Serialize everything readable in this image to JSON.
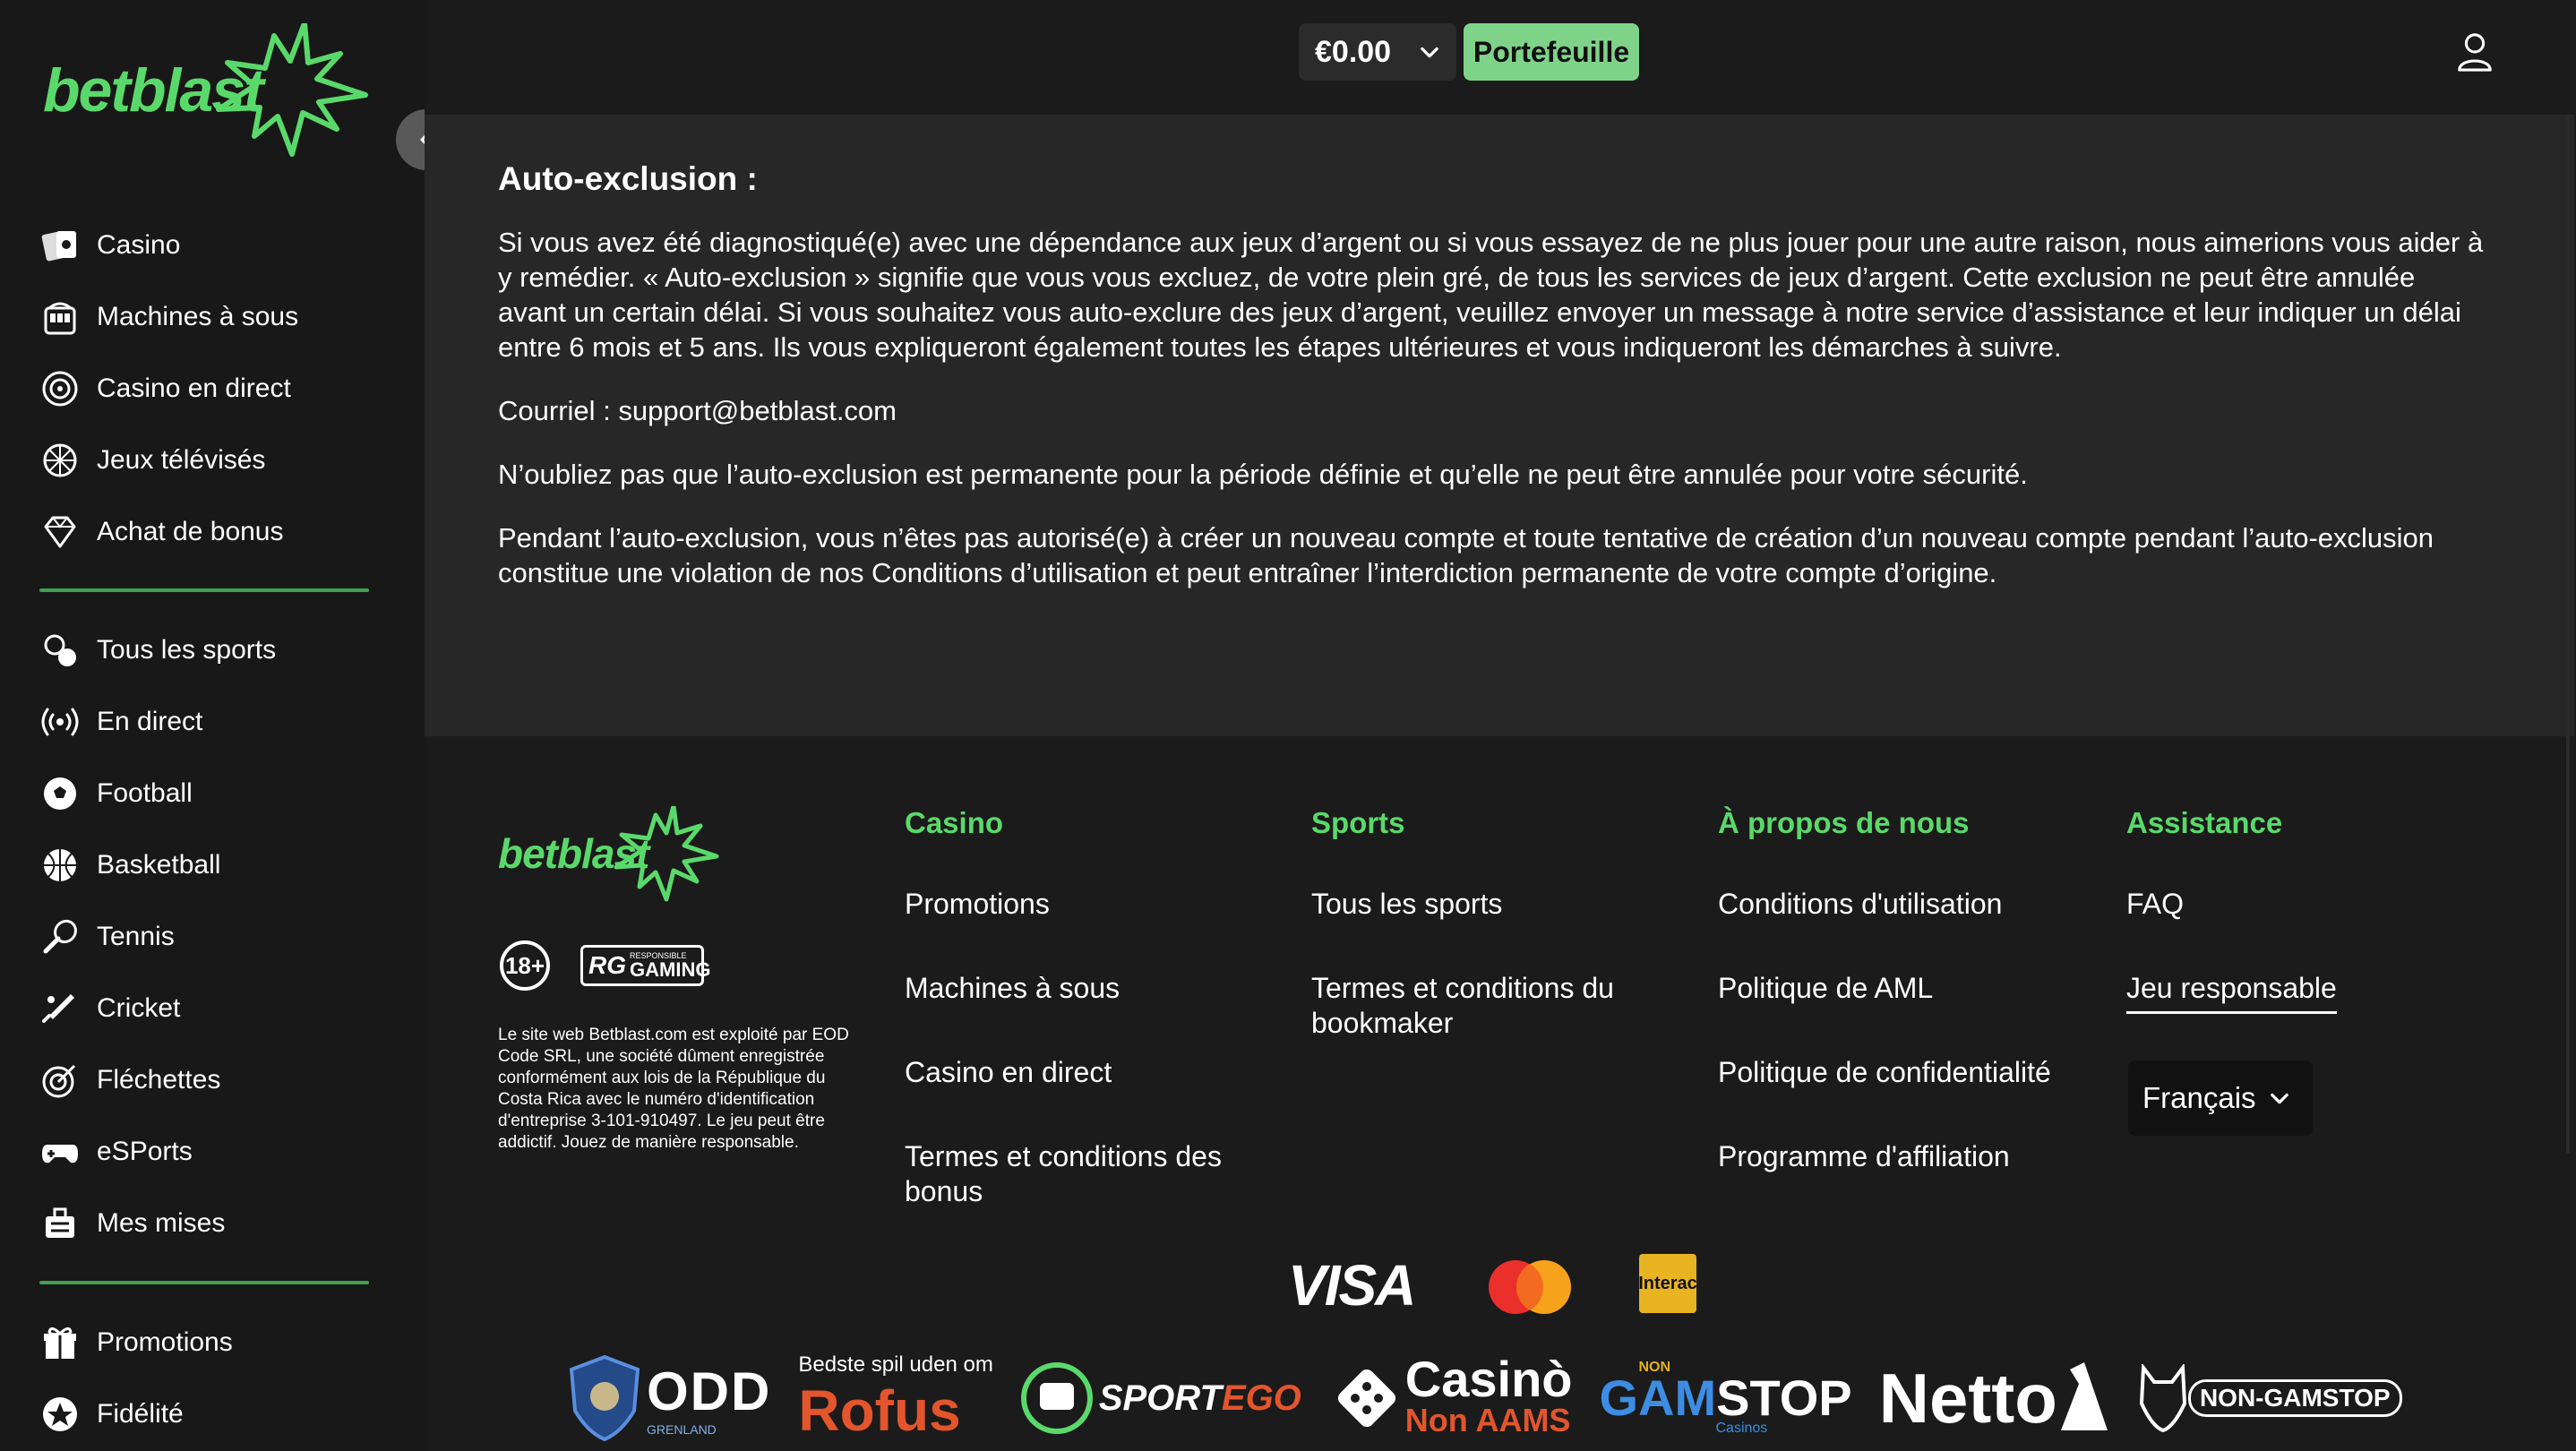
{
  "brand": {
    "name": "betblast",
    "accent": "#5ad96b",
    "button_color": "#7ed389"
  },
  "sidebar": {
    "group1": [
      {
        "icon": "cards-icon",
        "label": "Casino"
      },
      {
        "icon": "slot-machine-icon",
        "label": "Machines à sous"
      },
      {
        "icon": "roulette-icon",
        "label": "Casino en direct"
      },
      {
        "icon": "wheel-icon",
        "label": "Jeux télévisés"
      },
      {
        "icon": "diamond-icon",
        "label": "Achat de bonus"
      }
    ],
    "group2": [
      {
        "icon": "sports-icon",
        "label": "Tous les sports"
      },
      {
        "icon": "live-icon",
        "label": "En direct"
      },
      {
        "icon": "football-icon",
        "label": "Football"
      },
      {
        "icon": "basketball-icon",
        "label": "Basketball"
      },
      {
        "icon": "tennis-icon",
        "label": "Tennis"
      },
      {
        "icon": "cricket-icon",
        "label": "Cricket"
      },
      {
        "icon": "darts-icon",
        "label": "Fléchettes"
      },
      {
        "icon": "gamepad-icon",
        "label": "eSPorts"
      },
      {
        "icon": "bets-icon",
        "label": "Mes mises"
      }
    ],
    "group3": [
      {
        "icon": "gift-icon",
        "label": "Promotions"
      },
      {
        "icon": "star-icon",
        "label": "Fidélité"
      }
    ]
  },
  "topbar": {
    "balance": "€0.00",
    "wallet_label": "Portefeuille"
  },
  "content": {
    "heading": "Auto-exclusion :",
    "paragraphs": [
      "Si vous avez été diagnostiqué(e) avec une dépendance aux jeux d’argent ou si vous essayez de ne plus jouer pour une autre raison, nous aimerions vous aider à y remédier. « Auto-exclusion » signifie que vous vous excluez, de votre plein gré, de tous les services de jeux d’argent. Cette exclusion ne peut être annulée avant un certain délai. Si vous souhaitez vous auto-exclure des jeux d’argent, veuillez envoyer un message à notre service d’assistance et leur indiquer un délai entre 6 mois et 5 ans. Ils vous expliqueront également toutes les étapes ultérieures et vous indiqueront les démarches à suivre.",
      "Courriel : support@betblast.com",
      "N’oubliez pas que l’auto-exclusion est permanente pour la période définie et qu’elle ne peut être annulée pour votre sécurité.",
      "Pendant l’auto-exclusion, vous n’êtes pas autorisé(e) à créer un nouveau compte et toute tentative de création d’un nouveau compte pendant l’auto-exclusion constitue une violation de nos Conditions d’utilisation et peut entraîner l’interdiction permanente de votre compte d’origine."
    ]
  },
  "footer": {
    "badge_18": "18+",
    "rg_small": "RESPONSIBLE",
    "rg_big": "GAMING",
    "rg_mark": "RG",
    "legal": "Le site web Betblast.com est exploité par EOD Code SRL, une société dûment enregistrée conformément aux lois de la République du Costa Rica avec le numéro d'identification d'entreprise 3-101-910497. Le jeu peut être addictif. Jouez de manière responsable.",
    "columns": [
      {
        "title": "Casino",
        "links": [
          "Promotions",
          "Machines à sous",
          "Casino en direct",
          "Termes et conditions des bonus"
        ]
      },
      {
        "title": "Sports",
        "links": [
          "Tous les sports",
          "Termes et conditions du bookmaker"
        ]
      },
      {
        "title": "À propos de nous",
        "links": [
          "Conditions d'utilisation",
          "Politique de AML",
          "Politique de confidentialité",
          "Programme d'affiliation"
        ]
      },
      {
        "title": "Assistance",
        "links": [
          "FAQ",
          "Jeu responsable"
        ]
      }
    ],
    "language": "Français",
    "payments": {
      "visa": "VISA",
      "interac": "Interac"
    },
    "partners": {
      "odd": "ODD",
      "odd_sub": "GRENLAND",
      "rofus_top": "Bedste spil uden om",
      "rofus": "Rofus",
      "sportego_a": "SPORT",
      "sportego_b": "EGO",
      "casino": "Casinò",
      "casino_sub": "Non AAMS",
      "gamstop_non": "NON",
      "gamstop_a": "GAM",
      "gamstop_b": "STOP",
      "gamstop_sub": "Casinos",
      "netto": "Netto",
      "nongamstop": "NON-GAMSTOP"
    }
  }
}
